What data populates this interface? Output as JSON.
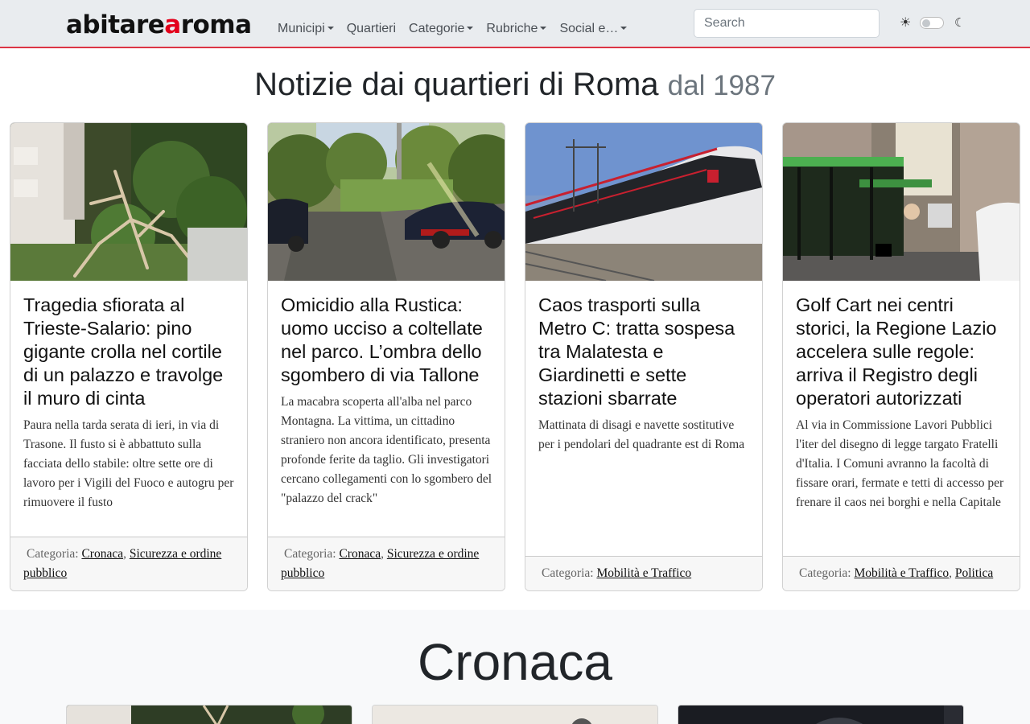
{
  "navbar": {
    "logo_part1": "abitare",
    "logo_accent": "a",
    "logo_part2": "roma",
    "menu": [
      {
        "label": "Municipi",
        "dropdown": true
      },
      {
        "label": "Quartieri",
        "dropdown": false
      },
      {
        "label": "Categorie",
        "dropdown": true
      },
      {
        "label": "Rubriche",
        "dropdown": true
      },
      {
        "label": "Social e…",
        "dropdown": true
      }
    ],
    "search_placeholder": "Search",
    "theme_sun_icon": "☀",
    "theme_moon_icon": "☾",
    "accent_color": "#dc3545"
  },
  "headline": {
    "main": "Notizie dai quartieri di Roma",
    "muted": "dal 1987"
  },
  "cards": [
    {
      "title": "Tragedia sfiorata al Trieste-Salario: pino gigante crolla nel cortile di un palazzo e travolge il muro di cinta",
      "text": "Paura nella tarda serata di ieri, in via di Trasone. Il fusto si è abbattuto sulla facciata dello stabile: oltre sette ore di lavoro per i Vigili del Fuoco e autogru per rimuovere il fusto",
      "category_label": "Categoria:",
      "categories": [
        "Cronaca",
        "Sicurezza e ordine pubblico"
      ]
    },
    {
      "title": "Omicidio alla Rustica: uomo ucciso a coltellate nel parco. L’ombra dello sgombero di via Tallone",
      "text": "La macabra scoperta all'alba nel parco Montagna. La vittima, un cittadino straniero non ancora identificato, presenta profonde ferite da taglio. Gli investigatori cercano collegamenti con lo sgombero del \"palazzo del crack\"",
      "category_label": "Categoria:",
      "categories": [
        "Cronaca",
        "Sicurezza e ordine pubblico"
      ]
    },
    {
      "title": "Caos trasporti sulla Metro C: tratta sospesa tra Malatesta e Giardinetti e sette stazioni sbarrate",
      "text": "Mattinata di disagi e navette sostitutive per i pendolari del quadrante est di Roma",
      "category_label": "Categoria:",
      "categories": [
        "Mobilità e Traffico"
      ]
    },
    {
      "title": "Golf Cart nei centri storici, la Regione Lazio accelera sulle regole: arriva il Registro degli operatori autorizzati",
      "text": "Al via in Commissione Lavori Pubblici l'iter del disegno di legge targato Fratelli d'Italia. I Comuni avranno la facoltà di fissare orari, fermate e tetti di accesso per frenare il caos nei borghi e nella Capitale",
      "category_label": "Categoria:",
      "categories": [
        "Mobilità e Traffico",
        "Politica"
      ]
    }
  ],
  "section": {
    "title": "Cronaca"
  }
}
